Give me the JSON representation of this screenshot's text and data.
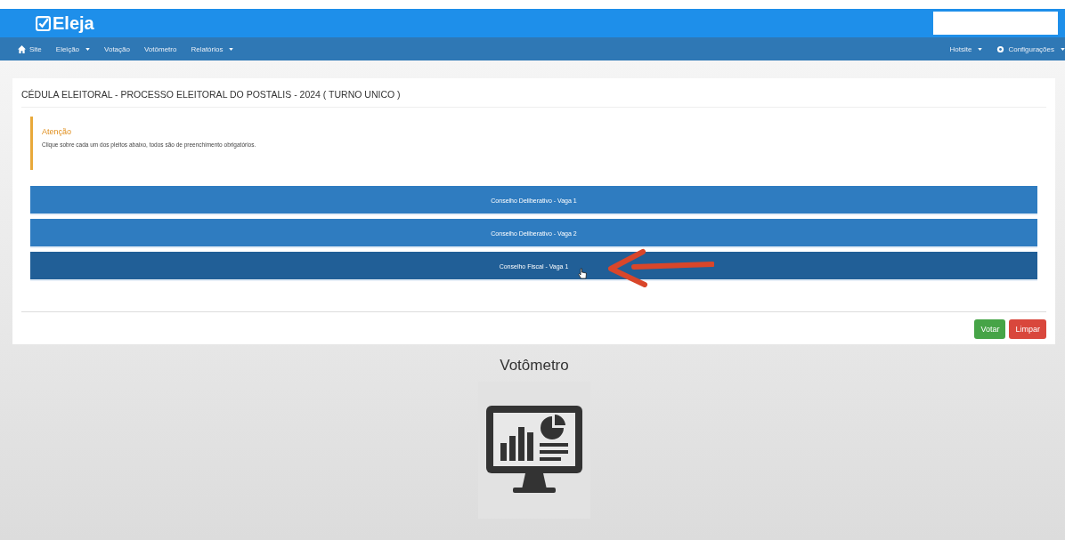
{
  "header": {
    "logo": "Eleja"
  },
  "nav": {
    "left": [
      {
        "label": "Site",
        "kind": "home"
      },
      {
        "label": "Eleição",
        "kind": "dropdown"
      },
      {
        "label": "Votação",
        "kind": "link"
      },
      {
        "label": "Votômetro",
        "kind": "link"
      },
      {
        "label": "Relatórios",
        "kind": "dropdown"
      }
    ],
    "right": [
      {
        "label": "Hotsite",
        "kind": "dropdown"
      },
      {
        "label": "Configurações",
        "kind": "settings"
      }
    ]
  },
  "panel": {
    "title": "CÉDULA ELEITORAL - PROCESSO ELEITORAL DO POSTALIS - 2024 ( TURNO UNICO )",
    "alert": {
      "heading": "Atenção",
      "text": "Clique sobre cada um dos pleitos abaixo, todos são de preenchimento obrigatórios."
    },
    "ballots": [
      {
        "label": "Conselho Deliberativo - Vaga 1",
        "hovered": false
      },
      {
        "label": "Conselho Deliberativo - Vaga 2",
        "hovered": false
      },
      {
        "label": "Conselho Fiscal - Vaga 1",
        "hovered": true
      }
    ],
    "actions": [
      {
        "label": "Votar",
        "kind": "success"
      },
      {
        "label": "Limpar",
        "kind": "danger"
      }
    ]
  },
  "votometro": {
    "title": "Votômetro"
  }
}
